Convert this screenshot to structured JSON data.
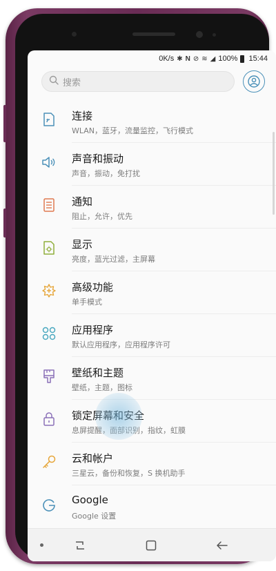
{
  "status_bar": {
    "network_speed": "0K/s",
    "icons": [
      "bluetooth-icon",
      "nfc-icon",
      "mute-icon",
      "wifi-icon",
      "signal-icon"
    ],
    "battery": "100%",
    "time": "15:44"
  },
  "search": {
    "placeholder": "搜索"
  },
  "settings": [
    {
      "title": "连接",
      "subtitle": "WLAN，蓝牙，流量监控，飞行模式",
      "icon": "connection-icon",
      "color": "#4a90b8"
    },
    {
      "title": "声音和振动",
      "subtitle": "声音，振动，免打扰",
      "icon": "sound-icon",
      "color": "#4a90b8"
    },
    {
      "title": "通知",
      "subtitle": "阻止，允许，优先",
      "icon": "notification-icon",
      "color": "#e0794f"
    },
    {
      "title": "显示",
      "subtitle": "亮度，蓝光过滤，主屏幕",
      "icon": "display-icon",
      "color": "#8fae3a"
    },
    {
      "title": "高级功能",
      "subtitle": "单手模式",
      "icon": "advanced-features-icon",
      "color": "#e6a63a"
    },
    {
      "title": "应用程序",
      "subtitle": "默认应用程序，应用程序许可",
      "icon": "apps-icon",
      "color": "#4aa8c0"
    },
    {
      "title": "壁纸和主题",
      "subtitle": "壁纸，主题，图标",
      "icon": "wallpaper-icon",
      "color": "#8a6fb8"
    },
    {
      "title": "锁定屏幕和安全",
      "subtitle": "息屏提醒，面部识别，指纹，虹膜",
      "icon": "lock-icon",
      "color": "#8a6fb8"
    },
    {
      "title": "云和帐户",
      "subtitle": "三星云，备份和恢复，S 换机助手",
      "icon": "key-icon",
      "color": "#e6a63a"
    },
    {
      "title": "Google",
      "subtitle": "Google 设置",
      "icon": "google-icon",
      "color": "#4a90b8"
    }
  ]
}
